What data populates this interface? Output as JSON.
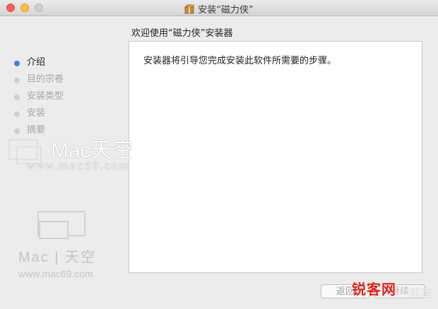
{
  "window": {
    "title": "安装“磁力侠”",
    "heading": "欢迎使用“磁力侠”安装器"
  },
  "sidebar": {
    "steps": [
      {
        "label": "介绍",
        "active": true
      },
      {
        "label": "目的宗卷",
        "active": false
      },
      {
        "label": "安装类型",
        "active": false
      },
      {
        "label": "安装",
        "active": false
      },
      {
        "label": "摘要",
        "active": false
      }
    ]
  },
  "content": {
    "text": "安装器将引导您完成安装此软件所需要的步骤。"
  },
  "watermarks": {
    "top_brand": "Mac天空",
    "top_url": "www.mac69.com",
    "bottom_brand": "Mac | 天空",
    "bottom_url": "www.mac69.com",
    "corner_stamp": "锐客网",
    "corner_suffix": "维吉"
  },
  "buttons": {
    "back": "返回",
    "next": "继续"
  },
  "colors": {
    "active_dot": "#3d82e3",
    "inactive_dot": "#d0d0d0",
    "stamp": "#e2231a"
  }
}
